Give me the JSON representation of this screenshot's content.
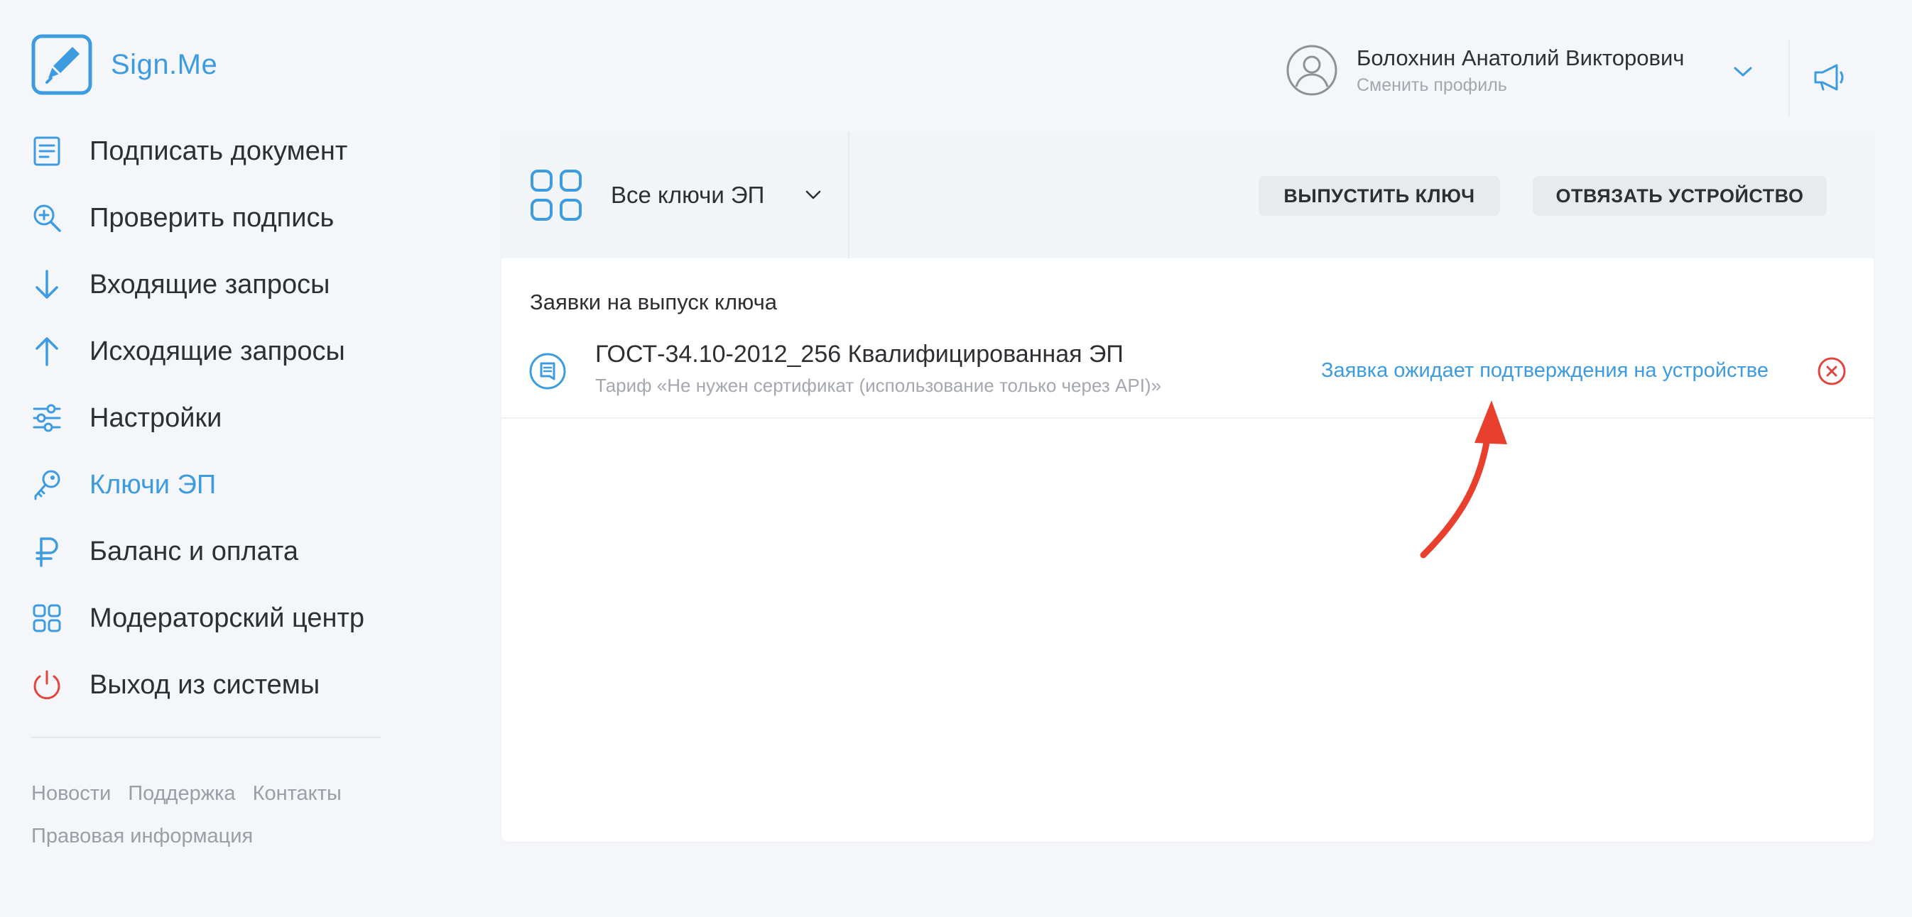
{
  "brand": {
    "name": "Sign.Me",
    "color": "#3d9be0"
  },
  "sidebar": {
    "items": [
      {
        "label": "Подписать документ",
        "icon": "document-icon",
        "active": false
      },
      {
        "label": "Проверить подпись",
        "icon": "search-check-icon",
        "active": false
      },
      {
        "label": "Входящие запросы",
        "icon": "arrow-down-icon",
        "active": false
      },
      {
        "label": "Исходящие запросы",
        "icon": "arrow-up-icon",
        "active": false
      },
      {
        "label": "Настройки",
        "icon": "sliders-icon",
        "active": false
      },
      {
        "label": "Ключи ЭП",
        "icon": "key-icon",
        "active": true
      },
      {
        "label": "Баланс и оплата",
        "icon": "ruble-icon",
        "active": false
      },
      {
        "label": "Модераторский центр",
        "icon": "grid-icon",
        "active": false
      },
      {
        "label": "Выход из системы",
        "icon": "power-icon",
        "active": false
      }
    ],
    "footer": {
      "news": "Новости",
      "support": "Поддержка",
      "contacts": "Контакты",
      "legal": "Правовая информация"
    }
  },
  "header": {
    "user_name": "Болохнин Анатолий Викторович",
    "switch_profile": "Сменить профиль"
  },
  "toolbar": {
    "filter_label": "Все ключи ЭП",
    "issue_key": "ВЫПУСТИТЬ КЛЮЧ",
    "unbind_device": "ОТВЯЗАТЬ УСТРОЙСТВО"
  },
  "requests": {
    "title": "Заявки на выпуск ключа",
    "items": [
      {
        "name": "ГОСТ-34.10-2012_256 Квалифицированная ЭП",
        "tariff": "Тариф «Не нужен сертификат (использование только через API)»",
        "status": "Заявка ожидает подтверждения на устройстве"
      }
    ]
  },
  "colors": {
    "accent": "#3d9be0",
    "danger": "#e0463d",
    "annotation_arrow": "#e8402c"
  }
}
